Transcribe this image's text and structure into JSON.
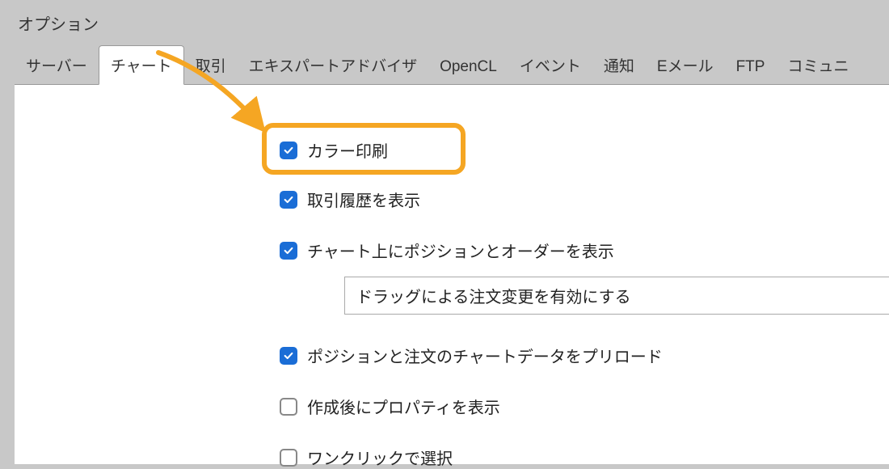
{
  "window": {
    "title": "オプション"
  },
  "tabs": [
    {
      "label": "サーバー"
    },
    {
      "label": "チャート"
    },
    {
      "label": "取引"
    },
    {
      "label": "エキスパートアドバイザ"
    },
    {
      "label": "OpenCL"
    },
    {
      "label": "イベント"
    },
    {
      "label": "通知"
    },
    {
      "label": "Eメール"
    },
    {
      "label": "FTP"
    },
    {
      "label": "コミュニ"
    }
  ],
  "options": {
    "color_print": {
      "label": "カラー印刷",
      "checked": true
    },
    "show_trade_history": {
      "label": "取引履歴を表示",
      "checked": true
    },
    "show_positions_orders": {
      "label": "チャート上にポジションとオーダーを表示",
      "checked": true
    },
    "drag_order_modify": {
      "label": "ドラッグによる注文変更を有効にする"
    },
    "preload_chart_data": {
      "label": "ポジションと注文のチャートデータをプリロード",
      "checked": true
    },
    "show_properties_after_create": {
      "label": "作成後にプロパティを表示",
      "checked": false
    },
    "one_click_select": {
      "label": "ワンクリックで選択",
      "checked": false
    }
  }
}
